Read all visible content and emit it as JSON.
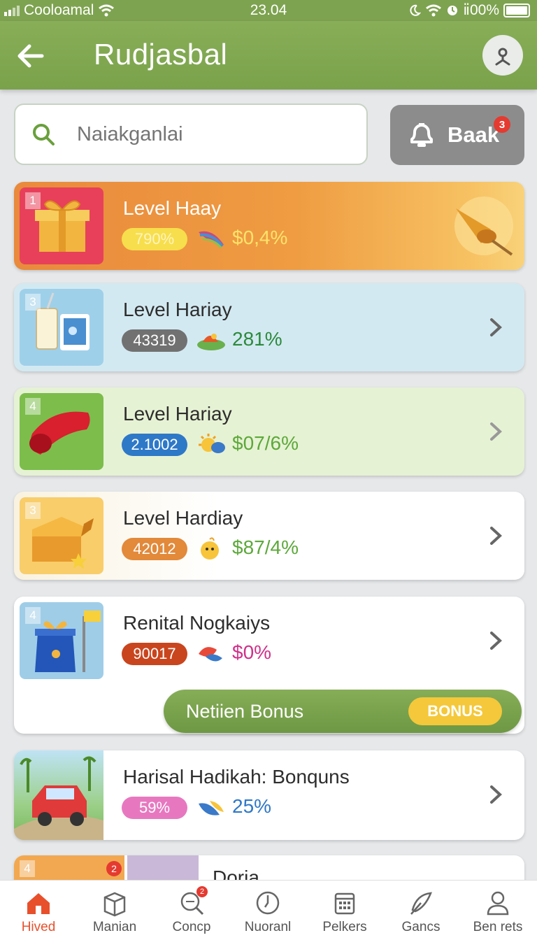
{
  "status_bar": {
    "carrier": "Cooloamal",
    "time": "23.04",
    "battery": "ⅱ00%"
  },
  "header": {
    "title": "Rudjasbal"
  },
  "search": {
    "placeholder": "Naiakganlai"
  },
  "header_button": {
    "label": "Baak",
    "badge": "3"
  },
  "cards": [
    {
      "rank": "1",
      "title": "Level Haay",
      "value": "790%",
      "percent": "$0,4%"
    },
    {
      "rank": "3",
      "title": "Level Hariay",
      "value": "43319",
      "percent": "281%"
    },
    {
      "rank": "4",
      "title": "Level Hariay",
      "value": "2.1002",
      "percent": "$07/6%"
    },
    {
      "rank": "3",
      "title": "Level Hardiay",
      "value": "42012",
      "percent": "$87/4%"
    },
    {
      "rank": "4",
      "title": "Renital Nogkaiys",
      "value": "90017",
      "percent": "$0%"
    },
    {
      "rank": "",
      "title": "Harisal Hadikah: Bonquns",
      "value": "59%",
      "percent": "25%"
    },
    {
      "rank": "4",
      "title": "Doria",
      "badge": "2"
    }
  ],
  "bonus": {
    "label": "Netiien Bonus",
    "button": "BONUS"
  },
  "tabs": [
    {
      "label": "Hived"
    },
    {
      "label": "Manian"
    },
    {
      "label": "Concp",
      "badge": "2"
    },
    {
      "label": "Nuoranl"
    },
    {
      "label": "Pelkers"
    },
    {
      "label": "Gancs"
    },
    {
      "label": "Ben rets"
    }
  ],
  "colors": {
    "primary_green": "#7ea350",
    "accent_orange": "#e8502c",
    "bonus_yellow": "#f4c83a"
  }
}
